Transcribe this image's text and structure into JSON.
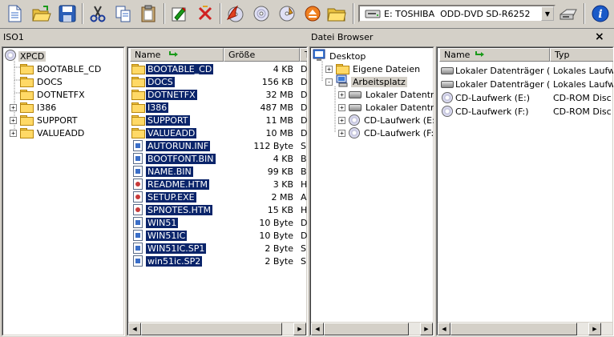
{
  "toolbar": {
    "drive_label": "E: TOSHIBA  ODD-DVD SD-R6252",
    "icons": [
      "new-icon",
      "open-icon",
      "save-icon",
      "cut-icon",
      "copy-icon",
      "paste-icon",
      "properties-icon",
      "delete-icon",
      "burn-icon",
      "cd-icon",
      "cd-info-icon",
      "eject-icon",
      "folder-icon",
      "drive-icon",
      "scan-icon",
      "info-icon"
    ]
  },
  "left_title": "ISO1",
  "right_title": "Datei Browser",
  "iso_tree": {
    "root": "XPCD",
    "items": [
      {
        "label": "BOOTABLE_CD",
        "expander": ""
      },
      {
        "label": "DOCS",
        "expander": ""
      },
      {
        "label": "DOTNETFX",
        "expander": ""
      },
      {
        "label": "I386",
        "expander": "+"
      },
      {
        "label": "SUPPORT",
        "expander": "+"
      },
      {
        "label": "VALUEADD",
        "expander": "+"
      }
    ]
  },
  "iso_list": {
    "columns": [
      "Name",
      "Größe",
      "T"
    ],
    "rows": [
      {
        "name": "BOOTABLE_CD",
        "size": "4 KB",
        "type": "D",
        "icon": "folder"
      },
      {
        "name": "DOCS",
        "size": "156 KB",
        "type": "D",
        "icon": "folder"
      },
      {
        "name": "DOTNETFX",
        "size": "32 MB",
        "type": "D",
        "icon": "folder"
      },
      {
        "name": "I386",
        "size": "487 MB",
        "type": "D",
        "icon": "folder"
      },
      {
        "name": "SUPPORT",
        "size": "11 MB",
        "type": "D",
        "icon": "folder"
      },
      {
        "name": "VALUEADD",
        "size": "10 MB",
        "type": "D",
        "icon": "folder"
      },
      {
        "name": "AUTORUN.INF",
        "size": "112 Byte",
        "type": "S",
        "icon": "blue"
      },
      {
        "name": "BOOTFONT.BIN",
        "size": "4 KB",
        "type": "B",
        "icon": "blue"
      },
      {
        "name": "NAME.BIN",
        "size": "99 KB",
        "type": "B",
        "icon": "blue"
      },
      {
        "name": "README.HTM",
        "size": "3 KB",
        "type": "H",
        "icon": "red"
      },
      {
        "name": "SETUP.EXE",
        "size": "2 MB",
        "type": "A",
        "icon": "red"
      },
      {
        "name": "SPNOTES.HTM",
        "size": "15 KB",
        "type": "H",
        "icon": "red"
      },
      {
        "name": "WIN51",
        "size": "10 Byte",
        "type": "D",
        "icon": "blue"
      },
      {
        "name": "WIN51IC",
        "size": "10 Byte",
        "type": "D",
        "icon": "blue"
      },
      {
        "name": "WIN51IC.SP1",
        "size": "2 Byte",
        "type": "S",
        "icon": "blue"
      },
      {
        "name": "win51ic.SP2",
        "size": "2 Byte",
        "type": "S",
        "icon": "blue"
      }
    ]
  },
  "browser_tree": {
    "items": [
      {
        "label": "Desktop",
        "expander": "",
        "indent": 0,
        "icon": "desktop"
      },
      {
        "label": "Eigene Dateien",
        "expander": "+",
        "indent": 1,
        "icon": "folder"
      },
      {
        "label": "Arbeitsplatz",
        "expander": "-",
        "indent": 1,
        "icon": "computer"
      },
      {
        "label": "Lokaler Datenträger",
        "expander": "+",
        "indent": 2,
        "icon": "drive"
      },
      {
        "label": "Lokaler Datenträger",
        "expander": "+",
        "indent": 2,
        "icon": "drive"
      },
      {
        "label": "CD-Laufwerk (E:)",
        "expander": "+",
        "indent": 2,
        "icon": "cd"
      },
      {
        "label": "CD-Laufwerk (F:)",
        "expander": "+",
        "indent": 2,
        "icon": "cd"
      }
    ]
  },
  "browser_list": {
    "columns": [
      "Name",
      "Typ"
    ],
    "rows": [
      {
        "name": "Lokaler Datenträger (...",
        "type": "Lokales Laufw",
        "icon": "drive"
      },
      {
        "name": "Lokaler Datenträger (...",
        "type": "Lokales Laufw",
        "icon": "drive"
      },
      {
        "name": "CD-Laufwerk (E:)",
        "type": "CD-ROM Disc",
        "icon": "cd"
      },
      {
        "name": "CD-Laufwerk (F:)",
        "type": "CD-ROM Disc",
        "icon": "cd"
      }
    ]
  },
  "colors": {
    "selection": "#0a246a",
    "chrome": "#d4d0c8"
  }
}
